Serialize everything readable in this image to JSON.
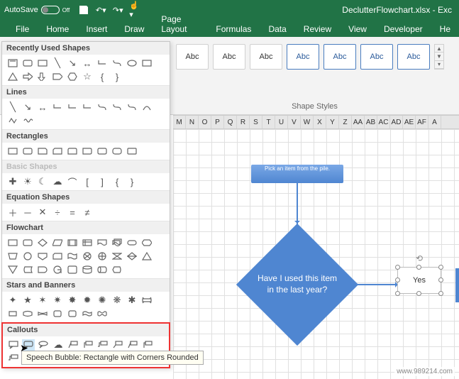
{
  "titlebar": {
    "autosave_label": "AutoSave",
    "autosave_state": "Off",
    "doc_title": "DeclutterFlowchart.xlsx - Exc"
  },
  "ribbon": {
    "tabs": [
      "File",
      "Home",
      "Insert",
      "Draw",
      "Page Layout",
      "Formulas",
      "Data",
      "Review",
      "View",
      "Developer",
      "He"
    ]
  },
  "shape_styles": {
    "label": "Shape Styles",
    "sample_text": "Abc"
  },
  "shapes_panel": {
    "recently_used": "Recently Used Shapes",
    "lines": "Lines",
    "rectangles": "Rectangles",
    "basic_shapes": "Basic Shapes",
    "equation": "Equation Shapes",
    "flowchart": "Flowchart",
    "stars": "Stars and Banners",
    "callouts": "Callouts",
    "tooltip": "Speech Bubble: Rectangle with Corners Rounded"
  },
  "columns": [
    "M",
    "N",
    "O",
    "P",
    "Q",
    "R",
    "S",
    "T",
    "U",
    "V",
    "W",
    "X",
    "Y",
    "Z",
    "AA",
    "AB",
    "AC",
    "AD",
    "AE",
    "AF",
    "A"
  ],
  "flowchart": {
    "process_text": "Pick an item from the pile.",
    "decision_text": "Have I used this item in the last year?",
    "yes_label": "Yes"
  },
  "watermark": "www.989214.com"
}
